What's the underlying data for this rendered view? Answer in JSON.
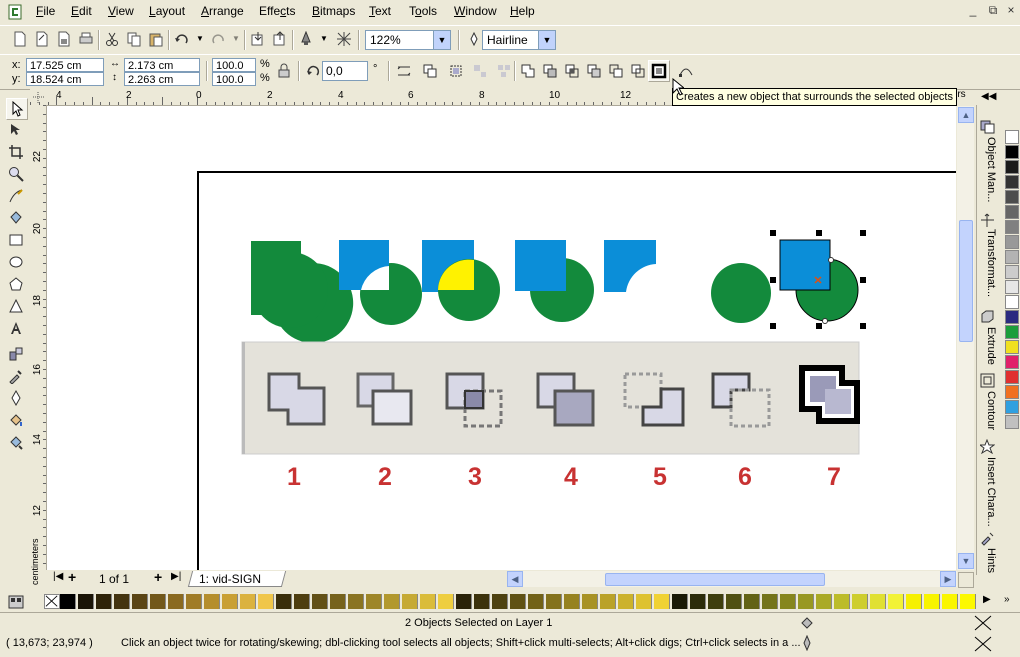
{
  "menu": [
    "File",
    "Edit",
    "View",
    "Layout",
    "Arrange",
    "Effects",
    "Bitmaps",
    "Text",
    "Tools",
    "Window",
    "Help"
  ],
  "menu_underline": [
    "F",
    "E",
    "V",
    "L",
    "A",
    "c",
    "B",
    "T",
    "o",
    "W",
    "H"
  ],
  "window_buttons": [
    "_",
    "⧉",
    "×"
  ],
  "standard_toolbar": {
    "zoom": "122%",
    "outline": "Hairline"
  },
  "property_bar": {
    "x_label": "x:",
    "x_value": "17.525 cm",
    "y_label": "y:",
    "y_value": "18.524 cm",
    "width_value": "2.173 cm",
    "height_value": "2.263 cm",
    "scale_x": "100.0",
    "scale_y": "100.0",
    "percent": "%",
    "rotation": "0,0",
    "degree": "°"
  },
  "tooltip": "Creates a new object that surrounds the selected objects",
  "ruler_h_numbers": [
    "4",
    "2",
    "0",
    "2",
    "4",
    "6",
    "8",
    "10",
    "12"
  ],
  "ruler_v_numbers": [
    "22",
    "20",
    "18",
    "16",
    "14",
    "12"
  ],
  "ruler_unit": "centimeters",
  "ruler_unit_short": "ters",
  "labels": [
    "1",
    "2",
    "3",
    "4",
    "5",
    "6",
    "7"
  ],
  "dockers": [
    "Object Man...",
    "Transformat...",
    "Extrude",
    "Contour",
    "Insert Chara...",
    "Hints"
  ],
  "page_nav": {
    "count": "1 of 1",
    "tab": "1: vid-SIGN"
  },
  "status": {
    "selection": "2 Objects Selected on Layer 1",
    "coords": "( 13,673; 23,974 )",
    "hint": "Click an object twice for rotating/skewing; dbl-clicking tool selects all objects; Shift+click multi-selects; Alt+click digs; Ctrl+click selects in a ..."
  },
  "colors": {
    "green": "#138a3c",
    "blue": "#0b8ed8",
    "yellow": "#fff200",
    "number": "#c83232"
  },
  "palette_h": [
    "#000000",
    "#1a1406",
    "#2e2308",
    "#443410",
    "#5b4514",
    "#72581a",
    "#8a6a20",
    "#a07c26",
    "#b58e2c",
    "#c9a034",
    "#dbb23e",
    "#f0c64a",
    "#3a2e0a",
    "#4e3e10",
    "#625016",
    "#76621c",
    "#8a7422",
    "#9e8628",
    "#b2982e",
    "#c6aa34",
    "#dabc3a",
    "#eece40",
    "#2a2308",
    "#3c320c",
    "#4e4210",
    "#605214",
    "#726218",
    "#84721c",
    "#968220",
    "#a89224",
    "#baa228",
    "#ccb22c",
    "#dec230",
    "#f0d234",
    "#1a1a06",
    "#2c2c0a",
    "#3e3e0e",
    "#505012",
    "#626216",
    "#74741a",
    "#86861e",
    "#989822",
    "#aaaa26",
    "#bcbc2a",
    "#cece2e",
    "#e0e032",
    "#f2f236",
    "#f6f000",
    "#f8f400",
    "#faf600",
    "#fcf800"
  ],
  "palette_v": [
    "#ffffff",
    "#000000",
    "#1a1a1a",
    "#333333",
    "#4d4d4d",
    "#666666",
    "#808080",
    "#999999",
    "#b3b3b3",
    "#cccccc",
    "#e6e6e6",
    "#ffffff",
    "#2b2b80",
    "#1b9d3a",
    "#f0e020",
    "#e0206a",
    "#e03030",
    "#f07020",
    "#30a0e0",
    "#c0c0c0"
  ]
}
